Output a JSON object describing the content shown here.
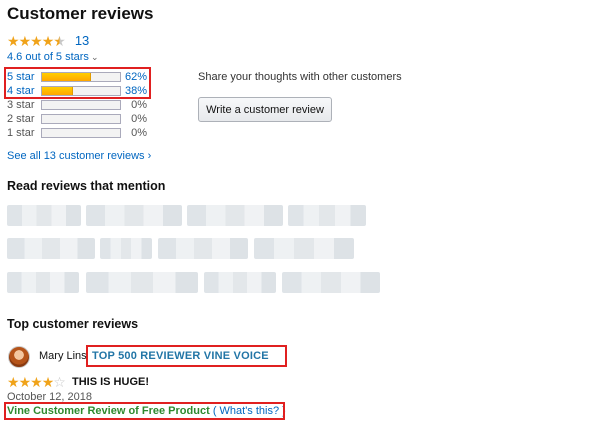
{
  "header": {
    "title": "Customer reviews"
  },
  "summary": {
    "star_rating": 4.5,
    "ratings_count": "13",
    "average_text": "4.6 out of 5 stars",
    "chevron": "›"
  },
  "histogram": [
    {
      "label": "5 star",
      "percent": "62%",
      "value": 62,
      "linked": true
    },
    {
      "label": "4 star",
      "percent": "38%",
      "value": 38,
      "linked": true
    },
    {
      "label": "3 star",
      "percent": "0%",
      "value": 0,
      "linked": false
    },
    {
      "label": "2 star",
      "percent": "0%",
      "value": 0,
      "linked": false
    },
    {
      "label": "1 star",
      "percent": "0%",
      "value": 0,
      "linked": false
    }
  ],
  "see_all": {
    "label": "See all 13 customer reviews ›"
  },
  "share": {
    "prompt": "Share your thoughts with other customers",
    "button_label": "Write a customer review"
  },
  "mentions": {
    "heading": "Read reviews that mention"
  },
  "top_reviews": {
    "heading": "Top customer reviews",
    "review": {
      "reviewer": "Mary Lins",
      "badge": "TOP 500 REVIEWER  VINE VOICE",
      "rating": 4,
      "title": "THIS IS HUGE!",
      "date": "October 12, 2018",
      "vine_label": "Vine Customer Review of Free Product",
      "whats_this": "( What's this? )"
    }
  },
  "colors": {
    "link": "#0066c0",
    "star": "#f0a31a",
    "highlight_box": "#e02020",
    "vine_green": "#2e8a2e",
    "badge_blue": "#2275a6"
  },
  "icons": {
    "star_full": "star-icon",
    "star_half": "half-star-icon",
    "star_empty": "empty-star-icon",
    "chevron": "chevron-down-icon"
  }
}
